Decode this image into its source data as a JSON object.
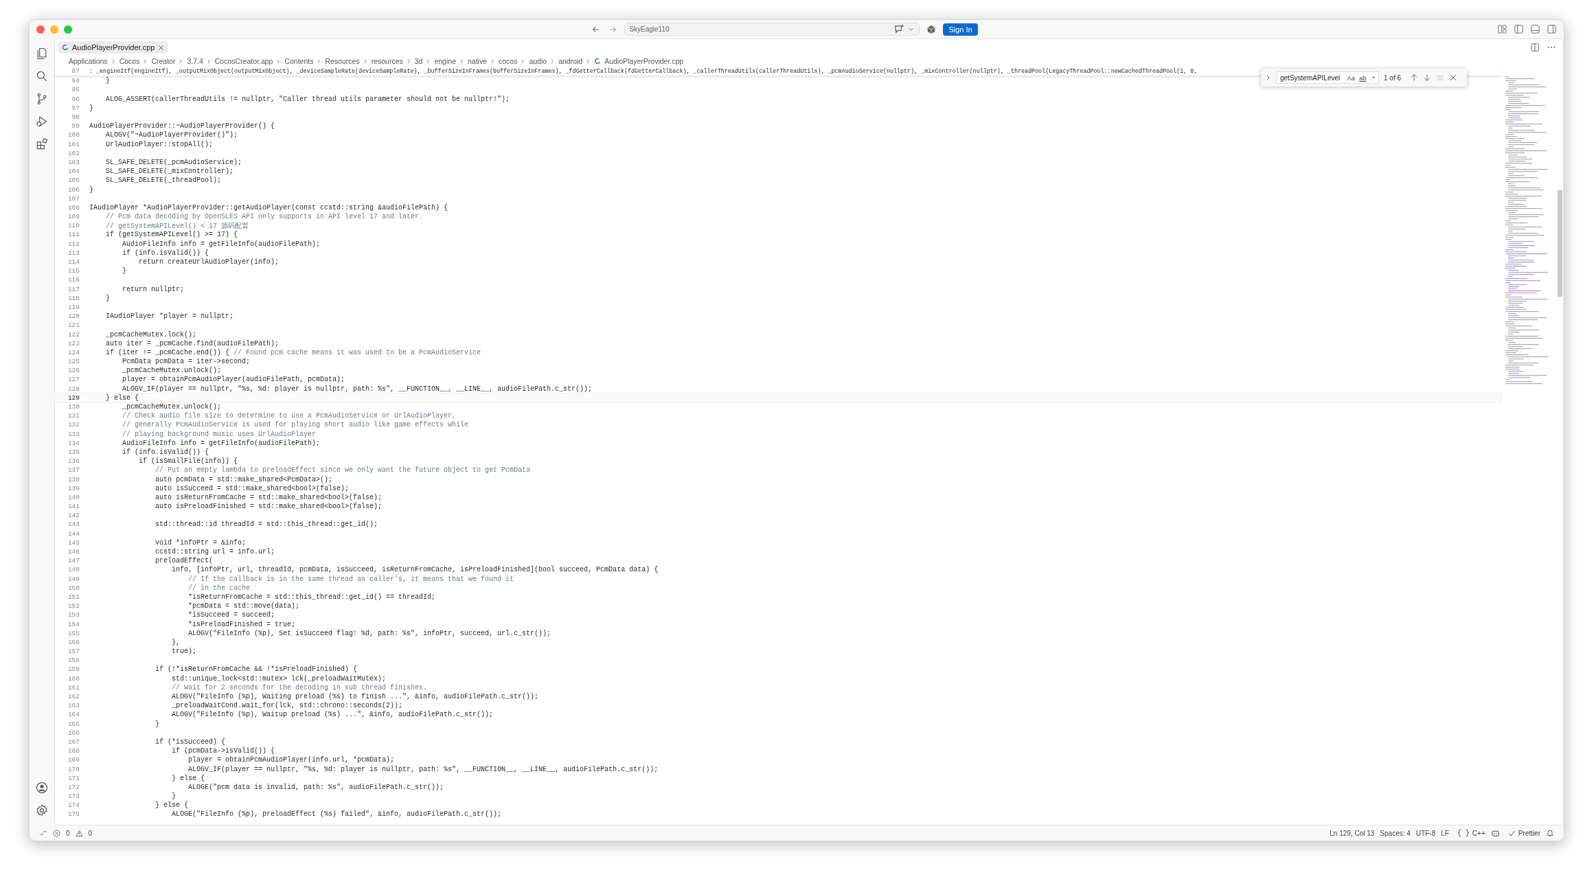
{
  "titlebar": {
    "search": {
      "value": "SkyEagle110"
    },
    "sign_in": "Sign In"
  },
  "tabs": [
    {
      "label": "AudioPlayerProvider.cpp",
      "selected": true
    }
  ],
  "breadcrumb": [
    "Applications",
    "Cocos",
    "Creator",
    "3.7.4",
    "CocosCreator.app",
    "Contents",
    "Resources",
    "resources",
    "3d",
    "engine",
    "native",
    "cocos",
    "audio",
    "android",
    "AudioPlayerProvider.cpp"
  ],
  "sticky_line": {
    "n": "87",
    "text": ": _engineItf(engineItf), _outputMixObject(outputMixObject), _deviceSampleRate(deviceSampleRate), _bufferSizeInFrames(bufferSizeInFrames), _fdGetterCallback(fdGetterCallback), _callerThreadUtils(callerThreadUtils), _pcmAudioService(nullptr), _mixController(nullptr), _threadPool(LegacyThreadPool::newCachedThreadPool(1, 8,"
  },
  "find": {
    "value": "getSystemAPILevel",
    "match_case": "Aa",
    "whole_word": "ab",
    "regex": ".*",
    "result": "1 of 6"
  },
  "lines": [
    {
      "n": "94",
      "text": "    }"
    },
    {
      "n": "95"
    },
    {
      "n": "96",
      "text": "    ALOG_ASSERT(callerThreadUtils != nullptr, \"Caller thread utils parameter should not be nullptr!\");"
    },
    {
      "n": "97",
      "text": "}"
    },
    {
      "n": "98"
    },
    {
      "n": "99",
      "text": "AudioPlayerProvider::~AudioPlayerProvider() {"
    },
    {
      "n": "100",
      "text": "    ALOGV(\"~AudioPlayerProvider()\");"
    },
    {
      "n": "101",
      "text": "    UrlAudioPlayer::stopAll();"
    },
    {
      "n": "102"
    },
    {
      "n": "103",
      "text": "    SL_SAFE_DELETE(_pcmAudioService);"
    },
    {
      "n": "104",
      "text": "    SL_SAFE_DELETE(_mixController);"
    },
    {
      "n": "105",
      "text": "    SL_SAFE_DELETE(_threadPool);"
    },
    {
      "n": "106",
      "text": "}"
    },
    {
      "n": "107"
    },
    {
      "n": "108",
      "text": "IAudioPlayer *AudioPlayerProvider::getAudioPlayer(const ccstd::string &audioFilePath) {"
    },
    {
      "n": "109",
      "comment": "    // Pcm data decoding by OpenSLES API only supports in API level 17 and later."
    },
    {
      "n": "110",
      "comment": "    // getSystemAPILevel() < 17 源码配置"
    },
    {
      "n": "111",
      "text": "    if (getSystemAPILevel() >= 17) {"
    },
    {
      "n": "112",
      "text": "        AudioFileInfo info = getFileInfo(audioFilePath);"
    },
    {
      "n": "113",
      "text": "        if (info.isValid()) {"
    },
    {
      "n": "114",
      "text": "            return createUrlAudioPlayer(info);"
    },
    {
      "n": "115",
      "text": "        }"
    },
    {
      "n": "116"
    },
    {
      "n": "117",
      "text": "        return nullptr;"
    },
    {
      "n": "118",
      "text": "    }"
    },
    {
      "n": "119"
    },
    {
      "n": "120",
      "text": "    IAudioPlayer *player = nullptr;"
    },
    {
      "n": "121"
    },
    {
      "n": "122",
      "text": "    _pcmCacheMutex.lock();"
    },
    {
      "n": "123",
      "text": "    auto iter = _pcmCache.find(audioFilePath);"
    },
    {
      "n": "124",
      "text": "    if (iter != _pcmCache.end()) { ",
      "comment": "// Found pcm cache means it was used to be a PcmAudioService"
    },
    {
      "n": "125",
      "text": "        PcmData pcmData = iter->second;"
    },
    {
      "n": "126",
      "text": "        _pcmCacheMutex.unlock();"
    },
    {
      "n": "127",
      "text": "        player = obtainPcmAudioPlayer(audioFilePath, pcmData);"
    },
    {
      "n": "128",
      "text": "        ALOGV_IF(player == nullptr, \"%s, %d: player is nullptr, path: %s\", __FUNCTION__, __LINE__, audioFilePath.c_str());"
    },
    {
      "n": "129",
      "text": "    } else {",
      "current": true
    },
    {
      "n": "130",
      "text": "        _pcmCacheMutex.unlock();"
    },
    {
      "n": "131",
      "comment": "        // Check audio file size to determine to use a PcmAudioService or UrlAudioPlayer,"
    },
    {
      "n": "132",
      "comment": "        // generally PcmAudioService is used for playing short audio like game effects while"
    },
    {
      "n": "133",
      "comment": "        // playing background music uses UrlAudioPlayer"
    },
    {
      "n": "134",
      "text": "        AudioFileInfo info = getFileInfo(audioFilePath);"
    },
    {
      "n": "135",
      "text": "        if (info.isValid()) {"
    },
    {
      "n": "136",
      "text": "            if (isSmallFile(info)) {"
    },
    {
      "n": "137",
      "comment": "                // Put an empty lambda to preloadEffect since we only want the future object to get PcmData"
    },
    {
      "n": "138",
      "text": "                auto pcmData = std::make_shared<PcmData>();"
    },
    {
      "n": "139",
      "text": "                auto isSucceed = std::make_shared<bool>(false);"
    },
    {
      "n": "140",
      "text": "                auto isReturnFromCache = std::make_shared<bool>(false);"
    },
    {
      "n": "141",
      "text": "                auto isPreloadFinished = std::make_shared<bool>(false);"
    },
    {
      "n": "142"
    },
    {
      "n": "143",
      "text": "                std::thread::id threadId = std::this_thread::get_id();"
    },
    {
      "n": "144"
    },
    {
      "n": "145",
      "text": "                void *infoPtr = &info;"
    },
    {
      "n": "146",
      "text": "                ccstd::string url = info.url;"
    },
    {
      "n": "147",
      "text": "                preloadEffect("
    },
    {
      "n": "148",
      "text": "                    info, [infoPtr, url, threadId, pcmData, isSucceed, isReturnFromCache, isPreloadFinished](bool succeed, PcmData data) {"
    },
    {
      "n": "149",
      "comment": "                        // If the callback is in the same thread as caller's, it means that we found it"
    },
    {
      "n": "150",
      "comment": "                        // in the cache"
    },
    {
      "n": "151",
      "text": "                        *isReturnFromCache = std::this_thread::get_id() == threadId;"
    },
    {
      "n": "152",
      "text": "                        *pcmData = std::move(data);"
    },
    {
      "n": "153",
      "text": "                        *isSucceed = succeed;"
    },
    {
      "n": "154",
      "text": "                        *isPreloadFinished = true;"
    },
    {
      "n": "155",
      "text": "                        ALOGV(\"FileInfo (%p), Set isSucceed flag: %d, path: %s\", infoPtr, succeed, url.c_str());"
    },
    {
      "n": "156",
      "text": "                    },"
    },
    {
      "n": "157",
      "text": "                    true);"
    },
    {
      "n": "158"
    },
    {
      "n": "159",
      "text": "                if (!*isReturnFromCache && !*isPreloadFinished) {"
    },
    {
      "n": "160",
      "text": "                    std::unique_lock<std::mutex> lck(_preloadWaitMutex);"
    },
    {
      "n": "161",
      "comment": "                    // Wait for 2 seconds for the decoding in sub thread finishes."
    },
    {
      "n": "162",
      "text": "                    ALOGV(\"FileInfo (%p), Waiting preload (%s) to finish ...\", &info, audioFilePath.c_str());"
    },
    {
      "n": "163",
      "text": "                    _preloadWaitCond.wait_for(lck, std::chrono::seconds(2));"
    },
    {
      "n": "164",
      "text": "                    ALOGV(\"FileInfo (%p), Waitup preload (%s) ...\", &info, audioFilePath.c_str());"
    },
    {
      "n": "165",
      "text": "                }"
    },
    {
      "n": "166"
    },
    {
      "n": "167",
      "text": "                if (*isSucceed) {"
    },
    {
      "n": "168",
      "text": "                    if (pcmData->isValid()) {"
    },
    {
      "n": "169",
      "text": "                        player = obtainPcmAudioPlayer(info.url, *pcmData);"
    },
    {
      "n": "170",
      "text": "                        ALOGV_IF(player == nullptr, \"%s, %d: player is nullptr, path: %s\", __FUNCTION__, __LINE__, audioFilePath.c_str());"
    },
    {
      "n": "171",
      "text": "                    } else {"
    },
    {
      "n": "172",
      "text": "                        ALOGE(\"pcm data is invalid, path: %s\", audioFilePath.c_str());"
    },
    {
      "n": "173",
      "text": "                    }"
    },
    {
      "n": "174",
      "text": "                } else {"
    },
    {
      "n": "175",
      "text": "                    ALOGE(\"FileInfo (%p), preloadEffect (%s) failed\", &info, audioFilePath.c_str());"
    }
  ],
  "status_bar": {
    "errors": "0",
    "warnings": "0",
    "position": "Ln 129, Col 13",
    "spaces": "Spaces: 4",
    "encoding": "UTF-8",
    "eol": "LF",
    "language_icon": "{ }",
    "language": "C++",
    "formatter": "Prettier"
  }
}
